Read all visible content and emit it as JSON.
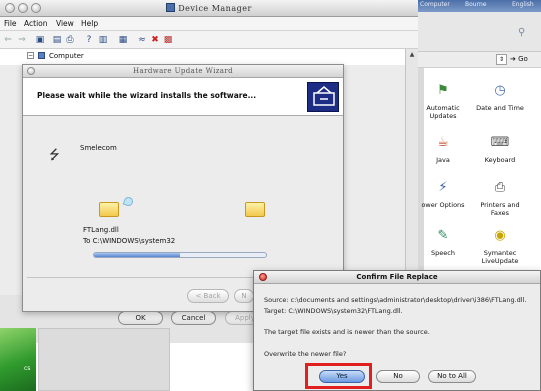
{
  "device_manager": {
    "title": "Device Manager",
    "menu": [
      "File",
      "Action",
      "View",
      "Help"
    ],
    "tree_root": "Computer",
    "buttons": {
      "ok": "OK",
      "cancel": "Cancel",
      "apply": "Apply"
    }
  },
  "wizard": {
    "title": "Hardware Update Wizard",
    "header": "Please wait while the wizard installs the software...",
    "device_name": "Smelecom",
    "file_name": "FTLang.dll",
    "file_dest": "To C:\\WINDOWS\\system32",
    "progress": 0.5,
    "back_label": "< Back",
    "next_label": "N"
  },
  "control_panel": {
    "top_bar": [
      "Computer",
      "Bourne",
      "English"
    ],
    "go_label": "Go",
    "items": [
      {
        "label": "Automatic Updates",
        "icon": "automatic-updates-icon",
        "glyph": "⚑",
        "color": "#3c8a3c"
      },
      {
        "label": "Date and Time",
        "icon": "clock-icon",
        "glyph": "◷",
        "color": "#4a6fb0"
      },
      {
        "label": "Java",
        "icon": "java-icon",
        "glyph": "☕",
        "color": "#c2431d"
      },
      {
        "label": "Keyboard",
        "icon": "keyboard-icon",
        "glyph": "⌨",
        "color": "#555555"
      },
      {
        "label": "ower Options",
        "icon": "power-options-icon",
        "glyph": "⚡",
        "color": "#3b62a8"
      },
      {
        "label": "Printers and Faxes",
        "icon": "printer-icon",
        "glyph": "⎙",
        "color": "#444444"
      },
      {
        "label": "Speech",
        "icon": "speech-icon",
        "glyph": "✎",
        "color": "#2f8a5e"
      },
      {
        "label": "Symantec LiveUpdate",
        "icon": "liveupdate-icon",
        "glyph": "◉",
        "color": "#c9a400"
      }
    ]
  },
  "confirm_dialog": {
    "title": "Confirm File Replace",
    "source": "Source: c:\\documents and settings\\administrator\\desktop\\driver\\i386\\FTLang.dll.",
    "target": "Target: C:\\WINDOWS\\system32\\FTLang.dll.",
    "message": "The target file exists and is newer than the source.",
    "question": "Overwrite the newer file?",
    "yes": "Yes",
    "no": "No",
    "no_to_all": "No to All"
  },
  "desktop_text": "cs",
  "colors": {
    "highlight": "#e01f1f",
    "default_button": "#6b9ae0"
  }
}
